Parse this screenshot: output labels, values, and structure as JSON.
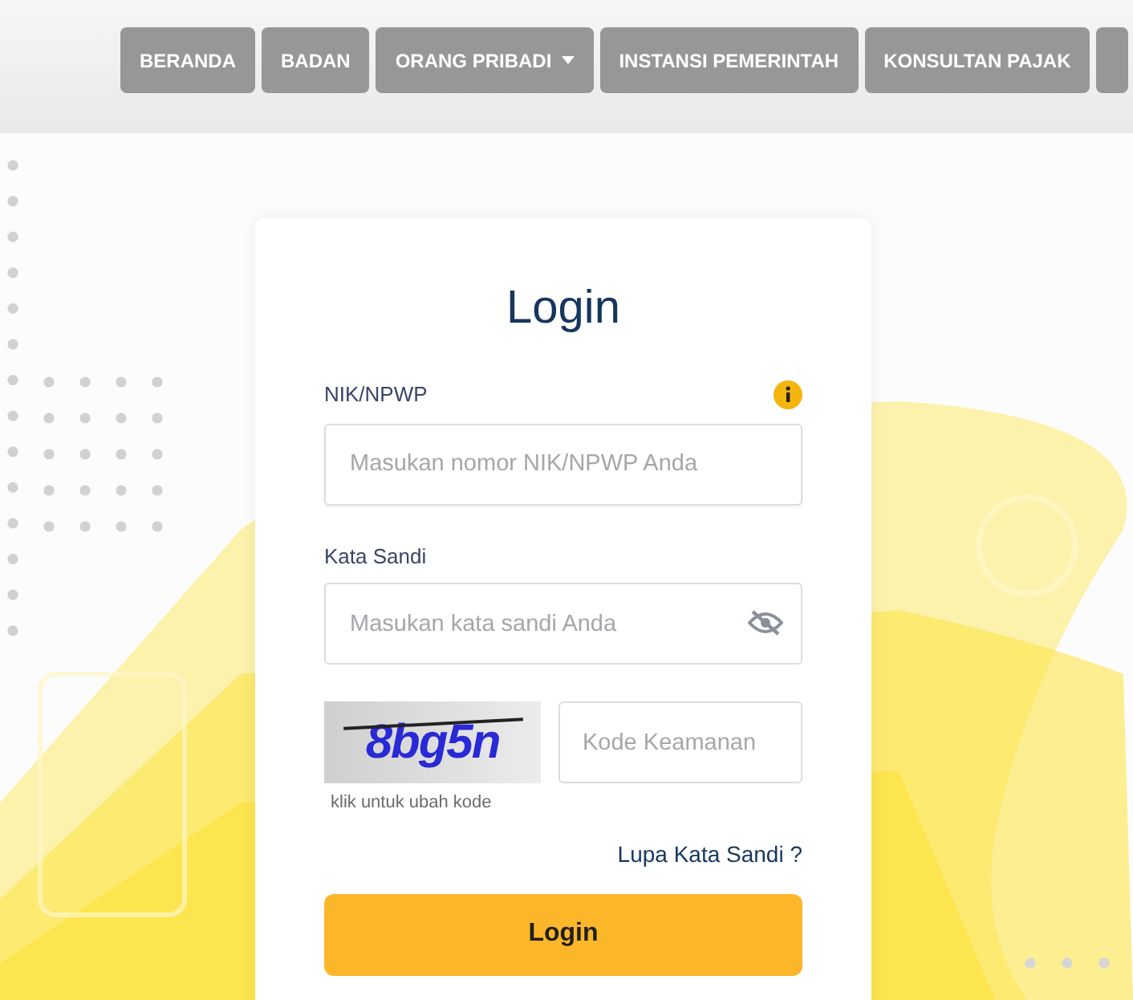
{
  "nav": [
    {
      "label": "BERANDA",
      "dropdown": false
    },
    {
      "label": "BADAN",
      "dropdown": false
    },
    {
      "label": "ORANG PRIBADI",
      "dropdown": true
    },
    {
      "label": "INSTANSI PEMERINTAH",
      "dropdown": false
    },
    {
      "label": "KONSULTAN PAJAK",
      "dropdown": false
    }
  ],
  "login": {
    "title": "Login",
    "id_field": {
      "label": "NIK/NPWP",
      "placeholder": "Masukan nomor NIK/NPWP Anda"
    },
    "password_field": {
      "label": "Kata Sandi",
      "placeholder": "Masukan kata sandi Anda",
      "visible": false
    },
    "captcha": {
      "code": "8bg5n",
      "hint": "klik untuk ubah kode",
      "placeholder": "Kode Keamanan"
    },
    "forgot_link": "Lupa Kata Sandi ?",
    "submit": "Login"
  }
}
